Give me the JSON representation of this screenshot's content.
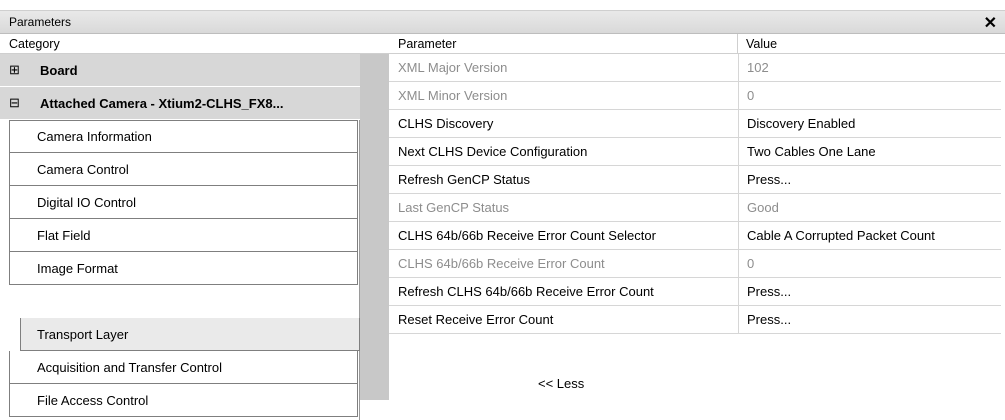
{
  "window": {
    "title": "Parameters",
    "close_glyph": "✕"
  },
  "headers": {
    "category": "Category",
    "parameter": "Parameter",
    "value": "Value"
  },
  "categories": [
    {
      "label": "Board",
      "expander": "⊞"
    },
    {
      "label": "Attached Camera - Xtium2-CLHS_FX8...",
      "expander": "⊟"
    }
  ],
  "category_items": [
    {
      "label": "Camera Information"
    },
    {
      "label": "Camera Control"
    },
    {
      "label": "Digital IO Control"
    },
    {
      "label": "Flat Field"
    },
    {
      "label": "Image Format"
    },
    {
      "label": "Transport Layer"
    },
    {
      "label": "Acquisition and Transfer Control"
    },
    {
      "label": "File Access Control"
    }
  ],
  "selected_category": "Transport Layer",
  "parameters": [
    {
      "name": "XML Major Version",
      "value": "102"
    },
    {
      "name": "XML Minor Version",
      "value": "0"
    },
    {
      "name": "CLHS Discovery",
      "value": "Discovery Enabled"
    },
    {
      "name": "Next CLHS Device Configuration",
      "value": "Two Cables One Lane"
    },
    {
      "name": "Refresh GenCP Status",
      "value": "Press..."
    },
    {
      "name": "Last GenCP Status",
      "value": "Good"
    },
    {
      "name": "CLHS 64b/66b Receive Error Count Selector",
      "value": "Cable A Corrupted Packet Count"
    },
    {
      "name": "CLHS 64b/66b Receive Error Count",
      "value": "0"
    },
    {
      "name": "Refresh CLHS 64b/66b Receive Error Count",
      "value": "Press..."
    },
    {
      "name": "Reset Receive Error Count",
      "value": "Press..."
    }
  ],
  "less_link": "<< Less"
}
